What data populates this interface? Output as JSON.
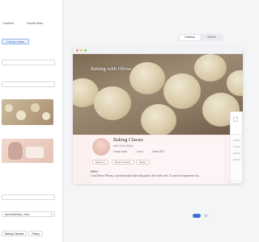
{
  "editor": {
    "tabs": [
      "Content",
      "Social links"
    ],
    "change_button": "Change avatar",
    "timezone": "America/New_York",
    "chips": [
      "Baking Classes",
      "Pastry"
    ]
  },
  "device_toggle": {
    "desktop": "Desktop",
    "mobile": "Mobile"
  },
  "preview": {
    "hero_title": "Baking with Olivia",
    "course_title": "Baking Classes",
    "course_sub": "with Olivia Wilson",
    "meta": [
      "Virtual class",
      "1 hour",
      "Starts $30"
    ],
    "tags": [
      "Beginner",
      "Bread Classes",
      "Pastry"
    ],
    "hello": "Hello!",
    "intro": "I am Olivia Wilson, a professional baker and pastry chef with over 12 years of experience in..."
  },
  "colors": {
    "accent": "#3b6fd6",
    "card_bg": "#fbefef"
  }
}
